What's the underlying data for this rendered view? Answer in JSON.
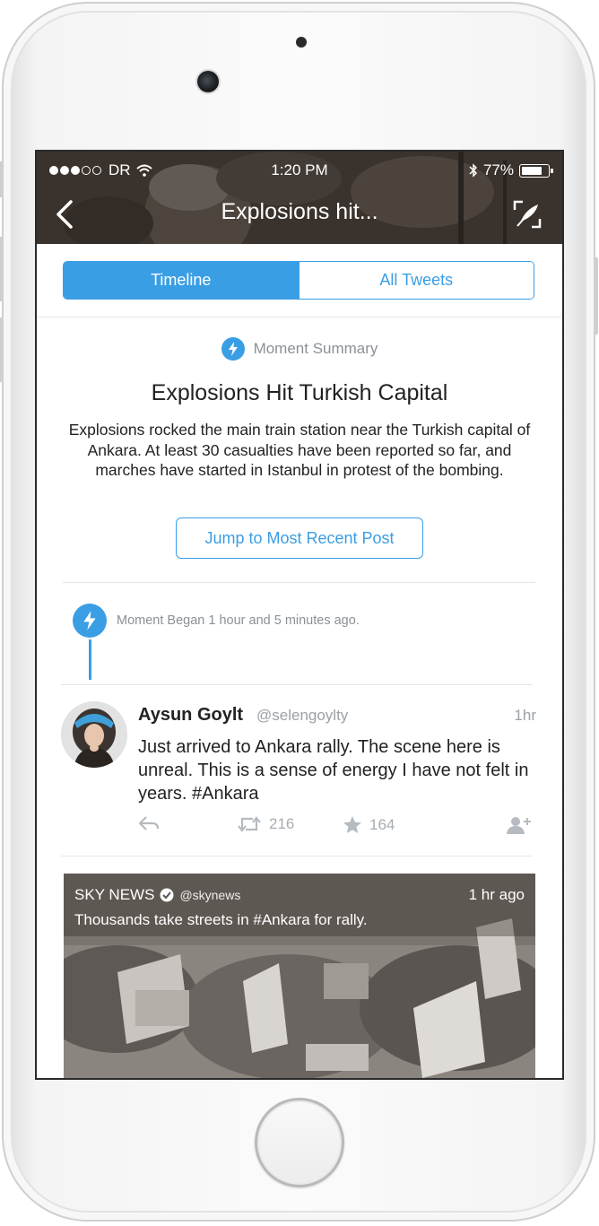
{
  "status_bar": {
    "carrier": "DR",
    "time": "1:20 PM",
    "battery": "77%"
  },
  "nav": {
    "title": "Explosions hit..."
  },
  "tabs": [
    {
      "label": "Timeline"
    },
    {
      "label": "All Tweets"
    }
  ],
  "summary": {
    "label": "Moment Summary",
    "headline": "Explosions Hit Turkish Capital",
    "description": "Explosions rocked the main train station near the Turkish capital of Ankara. At least 30 casualties have been reported so far, and marches have started in Istanbul in protest of the bombing.",
    "jump_label": "Jump to Most Recent Post"
  },
  "moment_began": "Moment Began 1 hour and 5 minutes ago.",
  "tweet": {
    "name": "Aysun Goylt",
    "handle": "@selengoylty",
    "time": "1hr",
    "text": "Just arrived to Ankara rally. The scene here is unreal. This is a sense of energy I have not felt in years. #Ankara",
    "retweets": "216",
    "likes": "164"
  },
  "media_card": {
    "source": "SKY NEWS",
    "handle": "@skynews",
    "time": "1 hr ago",
    "caption": "Thousands take streets in #Ankara for rally."
  },
  "colors": {
    "accent": "#3a9ee4",
    "text": "#222222",
    "muted": "#8a9197"
  }
}
